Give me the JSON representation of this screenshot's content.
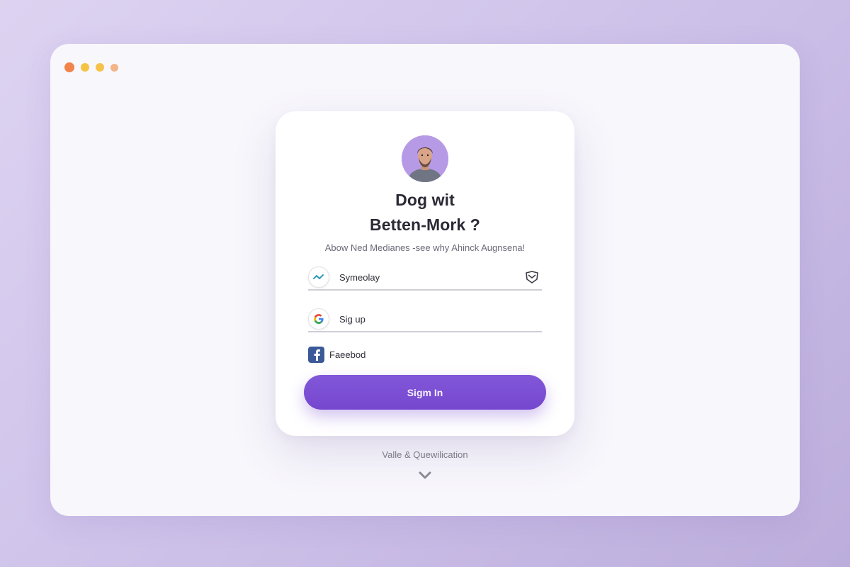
{
  "window": {
    "controls": [
      "close-dot",
      "minimize-dot",
      "maximize-dot",
      "extra-dot"
    ]
  },
  "card": {
    "avatar_icon": "user-avatar",
    "title_line1": "Dog wit",
    "title_line2": "Betten-Mork ?",
    "subtitle": "Abow Ned Medianes -see why Ahinck Augnsena!",
    "fields": [
      {
        "label": "Symeolay",
        "icon": "wave-icon",
        "trailing_icon": "mask-icon"
      },
      {
        "label": "Sig up",
        "icon": "google-icon"
      }
    ],
    "facebook": {
      "label": "Faeebod",
      "icon": "facebook-icon"
    },
    "sign_in_label": "Sigm In"
  },
  "footer": {
    "link": "Valle & Quewilication",
    "chevron_icon": "chevron-down-icon"
  },
  "colors": {
    "accent": "#7a4dd3",
    "background": "#cfc3ea",
    "window": "#f8f7fc"
  }
}
